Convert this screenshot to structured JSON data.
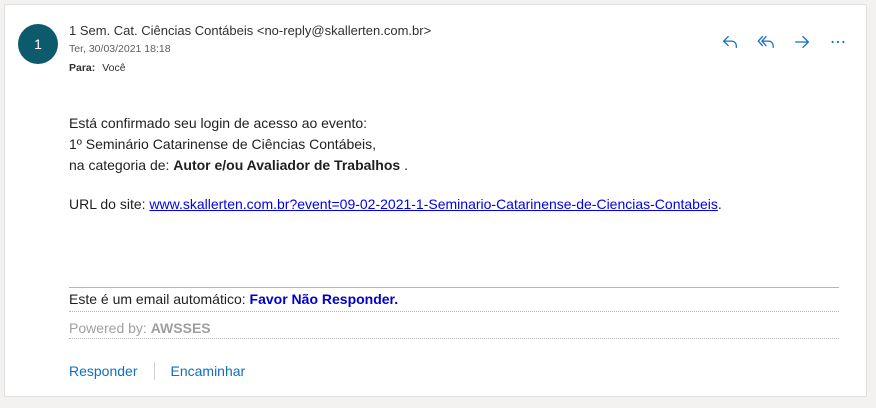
{
  "message": {
    "avatar_initial": "1",
    "from": "1 Sem. Cat. Ciências Contábeis <no-reply@skallerten.com.br>",
    "date": "Ter, 30/03/2021 18:18",
    "to_label": "Para:",
    "to_value": "Você",
    "actions": [
      {
        "icon": "reply-icon"
      },
      {
        "icon": "reply-all-icon"
      },
      {
        "icon": "forward-icon"
      },
      {
        "icon": "more-icon"
      }
    ],
    "accent": "#106ebe"
  },
  "body": {
    "line1": "Está confirmado seu login de acesso ao evento:",
    "line2": "1º Seminário Catarinense de Ciências Contábeis,",
    "line3_prefix": "na categoria de: ",
    "line3_bold": "Autor e/ou Avaliador de Trabalhos",
    "line3_suffix": " .",
    "url_label": "URL do site: ",
    "url": "www.skallerten.com.br?event=09-02-2021-1-Seminario-Catarinense-de-Ciencias-Contabeis",
    "url_suffix": ".",
    "auto_prefix": "Este é um email automático: ",
    "auto_bold": "Favor Não Responder.",
    "powered_prefix": "Powered by: ",
    "powered_bold": "AWSSES"
  },
  "reply_bar": {
    "reply": "Responder",
    "forward": "Encaminhar"
  }
}
